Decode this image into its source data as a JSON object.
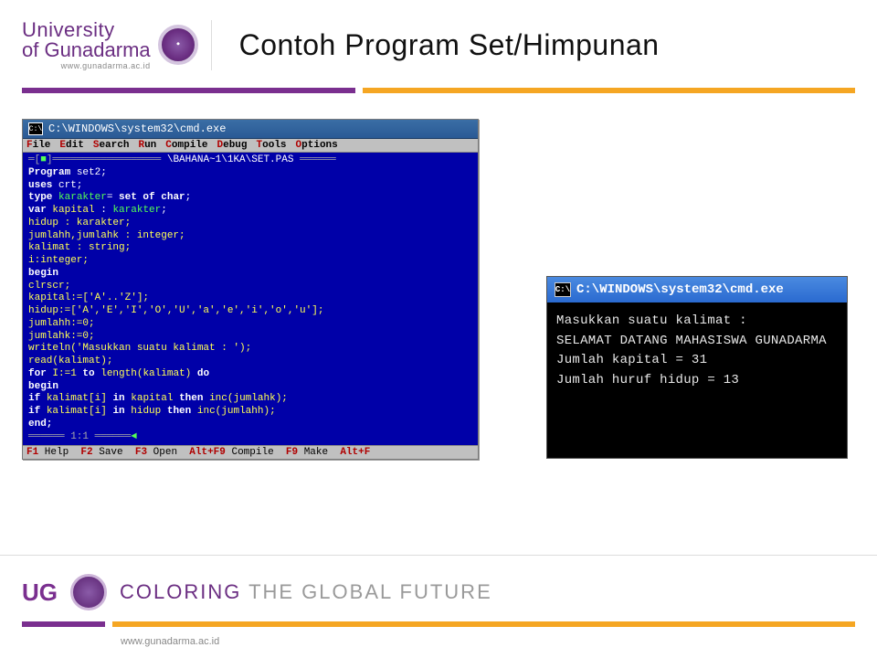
{
  "header": {
    "logo_line1": "University",
    "logo_line2": "of Gunadarma",
    "logo_url": "www.gunadarma.ac.id",
    "slide_title": "Contoh Program Set/Himpunan"
  },
  "editor": {
    "title": "C:\\WINDOWS\\system32\\cmd.exe",
    "cmd_glyph": "C:\\",
    "menu": [
      "File",
      "Edit",
      "Search",
      "Run",
      "Compile",
      "Debug",
      "Tools",
      "Options"
    ],
    "path_label": "\\BAHANA~1\\1KA\\SET.PAS",
    "code": {
      "l01a": "Program",
      "l01b": " set2;",
      "l02a": "uses",
      "l02b": " crt;",
      "l03a": "type ",
      "l03b": "karakter",
      "l03c": "= ",
      "l03d": "set of char",
      "l04a": "var ",
      "l04b": "kapital",
      "l04c": " : ",
      "l04d": "karakter",
      "l05a": "hidup : karakter;",
      "l06a": "jumlahh,jumlahk : integer;",
      "l07a": "kalimat : string;",
      "l08a": "i:integer;",
      "l09a": "begin",
      "l10a": "clrscr;",
      "l11a": "kapital:=['A'..'Z'];",
      "l12a": "hidup:=['A','E','I','O','U','a','e','i','o','u'];",
      "l13a": "jumlahh:=0;",
      "l14a": "jumlahk:=0;",
      "l15a": "writeln('Masukkan suatu kalimat : ');",
      "l16a": "read(kalimat);",
      "l17a": "for ",
      "l17b": "I:=1 ",
      "l17c": "to ",
      "l17d": "length(kalimat) ",
      "l17e": "do",
      "l18a": "begin",
      "l19a": "if ",
      "l19b": "kalimat[i] ",
      "l19c": "in ",
      "l19d": "kapital ",
      "l19e": "then ",
      "l19f": "inc(jumlahk);",
      "l20a": "if ",
      "l20b": "kalimat[i] ",
      "l20c": "in ",
      "l20d": "hidup ",
      "l20e": "then ",
      "l20f": "inc(jumlahh);",
      "l21a": "end;",
      "pos": "══════ 1:1 ══════"
    },
    "statusbar": "F1 Help  F2 Save  F3 Open  Alt+F9 Compile  F9 Make  Alt+F"
  },
  "output": {
    "title": "C:\\WINDOWS\\system32\\cmd.exe",
    "lines": "Masukkan suatu kalimat :\nSELAMAT DATANG MAHASISWA GUNADARMA\nJumlah kapital = 31\nJumlah huruf hidup = 13"
  },
  "footer": {
    "ug": "UG",
    "tagline_a": "COLORING",
    "tagline_b": " THE GLOBAL FUTURE",
    "url": "www.gunadarma.ac.id"
  }
}
